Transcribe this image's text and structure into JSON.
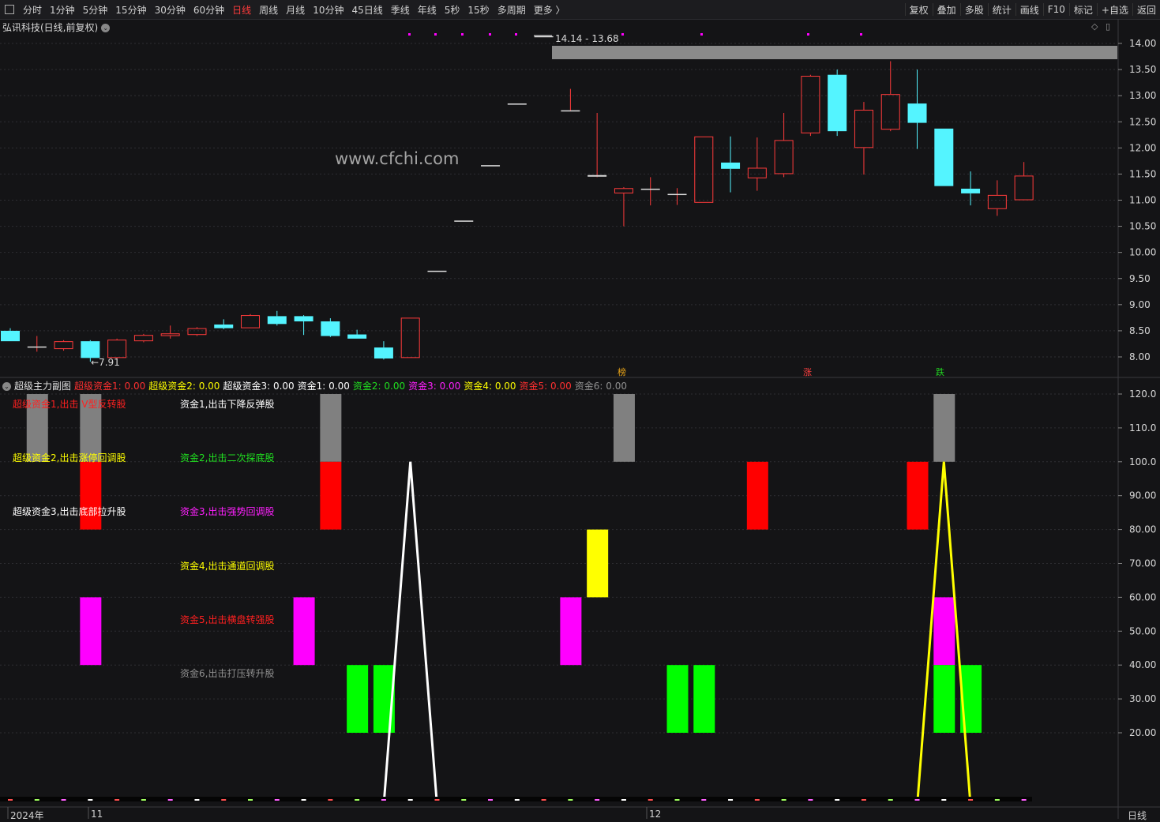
{
  "toolbar": {
    "periods": [
      "分时",
      "1分钟",
      "5分钟",
      "15分钟",
      "30分钟",
      "60分钟",
      "日线",
      "周线",
      "月线",
      "10分钟",
      "45日线",
      "季线",
      "年线",
      "5秒",
      "15秒",
      "多周期",
      "更多 〉"
    ],
    "active_period": "日线",
    "right_items": [
      "复权",
      "叠加",
      "多股",
      "统计",
      "画线",
      "F10",
      "标记",
      "+自选",
      "返回"
    ]
  },
  "stock": {
    "title": "弘讯科技(日线,前复权)"
  },
  "watermark": "www.cfchi.com",
  "main_chart": {
    "y_ticks": [
      "14.00",
      "13.50",
      "13.00",
      "12.50",
      "12.00",
      "11.50",
      "11.00",
      "10.50",
      "10.00",
      "9.50",
      "9.00",
      "8.50",
      "8.00"
    ],
    "high_label": "14.14 - 13.68",
    "low_label": "←7.91",
    "tags": [
      {
        "text": "榜",
        "color": "#e8a317"
      },
      {
        "text": "涨",
        "color": "#ff4040"
      },
      {
        "text": "跌",
        "color": "#20d020"
      }
    ]
  },
  "chart_data": {
    "type": "candlestick",
    "y_range": [
      7.8,
      14.1
    ],
    "candles": [
      {
        "o": 8.5,
        "c": 8.3,
        "h": 8.55,
        "l": 8.3
      },
      {
        "o": 8.2,
        "c": 8.2,
        "h": 8.4,
        "l": 8.1
      },
      {
        "o": 8.15,
        "c": 8.3,
        "h": 8.32,
        "l": 8.12
      },
      {
        "o": 8.3,
        "c": 7.98,
        "h": 8.32,
        "l": 7.91
      },
      {
        "o": 7.98,
        "c": 8.33,
        "h": 8.35,
        "l": 7.97
      },
      {
        "o": 8.3,
        "c": 8.42,
        "h": 8.44,
        "l": 8.28
      },
      {
        "o": 8.4,
        "c": 8.45,
        "h": 8.6,
        "l": 8.35
      },
      {
        "o": 8.42,
        "c": 8.55,
        "h": 8.57,
        "l": 8.4
      },
      {
        "o": 8.62,
        "c": 8.55,
        "h": 8.72,
        "l": 8.53
      },
      {
        "o": 8.55,
        "c": 8.8,
        "h": 8.82,
        "l": 8.55
      },
      {
        "o": 8.78,
        "c": 8.63,
        "h": 8.88,
        "l": 8.6
      },
      {
        "o": 8.78,
        "c": 8.68,
        "h": 8.8,
        "l": 8.42
      },
      {
        "o": 8.68,
        "c": 8.4,
        "h": 8.74,
        "l": 8.38
      },
      {
        "o": 8.43,
        "c": 8.35,
        "h": 8.52,
        "l": 8.35
      },
      {
        "o": 8.18,
        "c": 7.97,
        "h": 8.3,
        "l": 7.95
      },
      {
        "o": 7.98,
        "c": 8.75,
        "h": 8.75,
        "l": 7.98
      },
      {
        "o": 9.65,
        "c": 9.65,
        "h": 9.65,
        "l": 9.65
      },
      {
        "o": 10.61,
        "c": 10.61,
        "h": 10.61,
        "l": 10.61
      },
      {
        "o": 11.67,
        "c": 11.67,
        "h": 11.67,
        "l": 11.67
      },
      {
        "o": 12.85,
        "c": 12.85,
        "h": 12.85,
        "l": 12.85
      },
      {
        "o": 14.14,
        "c": 14.14,
        "h": 14.14,
        "l": 14.14
      },
      {
        "o": 12.72,
        "c": 12.72,
        "h": 13.13,
        "l": 12.72
      },
      {
        "o": 11.45,
        "c": 11.48,
        "h": 12.67,
        "l": 11.44
      },
      {
        "o": 11.13,
        "c": 11.23,
        "h": 11.25,
        "l": 10.5
      },
      {
        "o": 11.22,
        "c": 11.22,
        "h": 11.44,
        "l": 10.9
      },
      {
        "o": 11.12,
        "c": 11.12,
        "h": 11.23,
        "l": 10.91
      },
      {
        "o": 10.95,
        "c": 12.22,
        "h": 12.22,
        "l": 10.95
      },
      {
        "o": 11.72,
        "c": 11.6,
        "h": 12.22,
        "l": 11.15
      },
      {
        "o": 11.42,
        "c": 11.62,
        "h": 12.2,
        "l": 11.18
      },
      {
        "o": 11.5,
        "c": 12.15,
        "h": 12.67,
        "l": 11.44
      },
      {
        "o": 12.28,
        "c": 13.38,
        "h": 13.4,
        "l": 12.23
      },
      {
        "o": 13.4,
        "c": 12.32,
        "h": 13.5,
        "l": 12.23
      },
      {
        "o": 12.0,
        "c": 12.73,
        "h": 12.88,
        "l": 11.49
      },
      {
        "o": 12.35,
        "c": 13.03,
        "h": 13.66,
        "l": 12.32
      },
      {
        "o": 12.85,
        "c": 12.48,
        "h": 13.5,
        "l": 11.98
      },
      {
        "o": 12.37,
        "c": 11.27,
        "h": 12.37,
        "l": 11.27
      },
      {
        "o": 11.22,
        "c": 11.13,
        "h": 11.55,
        "l": 10.9
      },
      {
        "o": 10.83,
        "c": 11.1,
        "h": 11.38,
        "l": 10.7
      },
      {
        "o": 11.0,
        "c": 11.47,
        "h": 11.73,
        "l": 11.0
      }
    ]
  },
  "indicator": {
    "name": "超级主力副图",
    "values": [
      {
        "label": "超级资金1:",
        "value": "0.00",
        "color": "#ff3030"
      },
      {
        "label": "超级资金2:",
        "value": "0.00",
        "color": "#ffff00"
      },
      {
        "label": "超级资金3:",
        "value": "0.00",
        "color": "#ffffff"
      },
      {
        "label": "资金1:",
        "value": "0.00",
        "color": "#ffffff"
      },
      {
        "label": "资金2:",
        "value": "0.00",
        "color": "#20e020"
      },
      {
        "label": "资金3:",
        "value": "0.00",
        "color": "#ff20ff"
      },
      {
        "label": "资金4:",
        "value": "0.00",
        "color": "#ffff00"
      },
      {
        "label": "资金5:",
        "value": "0.00",
        "color": "#ff3030"
      },
      {
        "label": "资金6:",
        "value": "0.00",
        "color": "#909090"
      }
    ],
    "legend_left": [
      {
        "text": "超级资金1,出击 V型反转股",
        "color": "#ff2020"
      },
      {
        "text": "超级资金2,出击涨停回调股",
        "color": "#ffff00"
      },
      {
        "text": "超级资金3,出击底部拉升股",
        "color": "#ffffff"
      }
    ],
    "legend_right": [
      {
        "text": "资金1,出击下降反弹股",
        "color": "#ffffff"
      },
      {
        "text": "资金2,出击二次探底股",
        "color": "#20e020"
      },
      {
        "text": "资金3,出击强势回调股",
        "color": "#ff20ff"
      },
      {
        "text": "资金4,出击通道回调股",
        "color": "#ffff00"
      },
      {
        "text": "资金5,出击横盘转强股",
        "color": "#ff2020"
      },
      {
        "text": "资金6,出击打压转升股",
        "color": "#909090"
      }
    ],
    "y_ticks": [
      "120.0",
      "110.0",
      "100.0",
      "90.00",
      "80.00",
      "70.00",
      "60.00",
      "50.00",
      "40.00",
      "30.00",
      "20.00"
    ],
    "y_range": [
      0,
      120
    ]
  },
  "bars": [
    {
      "i": 1,
      "lo": 100,
      "hi": 120,
      "color": "#808080"
    },
    {
      "i": 3,
      "lo": 100,
      "hi": 120,
      "color": "#808080"
    },
    {
      "i": 3,
      "lo": 80,
      "hi": 100,
      "color": "#ff0000"
    },
    {
      "i": 3,
      "lo": 40,
      "hi": 60,
      "color": "#ff00ff"
    },
    {
      "i": 12,
      "lo": 100,
      "hi": 120,
      "color": "#808080"
    },
    {
      "i": 12,
      "lo": 80,
      "hi": 100,
      "color": "#ff0000"
    },
    {
      "i": 11,
      "lo": 40,
      "hi": 60,
      "color": "#ff00ff"
    },
    {
      "i": 13,
      "lo": 20,
      "hi": 40,
      "color": "#00ff00"
    },
    {
      "i": 14,
      "lo": 20,
      "hi": 40,
      "color": "#00ff00"
    },
    {
      "i": 21,
      "lo": 40,
      "hi": 60,
      "color": "#ff00ff"
    },
    {
      "i": 22,
      "lo": 60,
      "hi": 80,
      "color": "#ffff00"
    },
    {
      "i": 23,
      "lo": 100,
      "hi": 120,
      "color": "#808080"
    },
    {
      "i": 25,
      "lo": 20,
      "hi": 40,
      "color": "#00ff00"
    },
    {
      "i": 26,
      "lo": 20,
      "hi": 40,
      "color": "#00ff00"
    },
    {
      "i": 28,
      "lo": 80,
      "hi": 100,
      "color": "#ff0000"
    },
    {
      "i": 34,
      "lo": 80,
      "hi": 100,
      "color": "#ff0000"
    },
    {
      "i": 35,
      "lo": 100,
      "hi": 120,
      "color": "#808080"
    },
    {
      "i": 35,
      "lo": 40,
      "hi": 60,
      "color": "#ff00ff"
    },
    {
      "i": 35,
      "lo": 20,
      "hi": 40,
      "color": "#00ff00"
    },
    {
      "i": 36,
      "lo": 20,
      "hi": 40,
      "color": "#00ff00"
    }
  ],
  "spikes": [
    {
      "i": 15,
      "peak": 100,
      "color": "#ffffff"
    },
    {
      "i": 35,
      "peak": 100,
      "color": "#ffff00"
    }
  ],
  "x_axis": {
    "labels": [
      {
        "text": "2024年",
        "i": 0
      },
      {
        "text": "11",
        "i": 3
      },
      {
        "text": "12",
        "i": 24
      }
    ],
    "period": "日线"
  }
}
